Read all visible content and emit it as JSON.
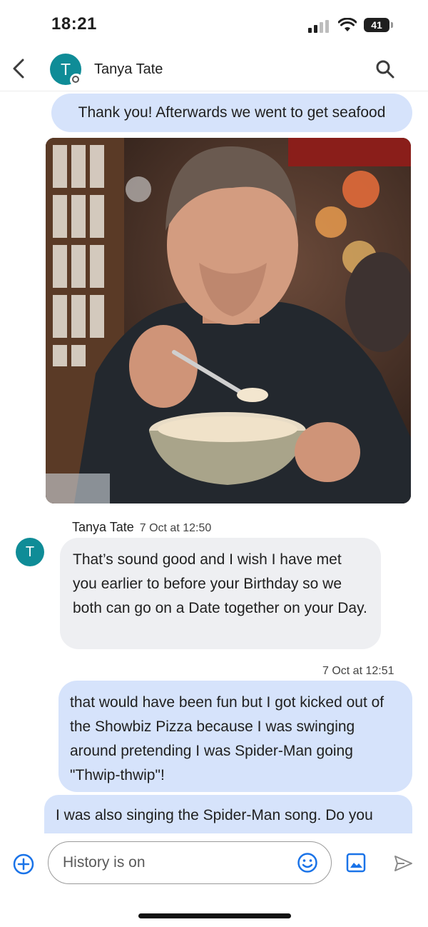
{
  "status_bar": {
    "time": "18:21",
    "battery": "41"
  },
  "header": {
    "avatar_initial": "T",
    "contact_name": "Tanya Tate"
  },
  "messages": [
    {
      "direction": "outgoing",
      "text": "Thank you! Afterwards we went to get seafood"
    },
    {
      "direction": "outgoing",
      "type": "image"
    },
    {
      "direction": "incoming",
      "sender": "Tanya Tate",
      "timestamp": "7 Oct at 12:50",
      "avatar_initial": "T",
      "text": "That’s sound good and I wish I have met you earlier to before your Birthday so we both can go on a Date together on your Day."
    },
    {
      "direction": "outgoing",
      "timestamp": "7 Oct at 12:51",
      "text": "that would have been fun but I got kicked out of the Showbiz Pizza because I was swinging around pretending I was Spider-Man going \"Thwip-thwip\"!"
    },
    {
      "direction": "outgoing",
      "text": "I was also singing the Spider-Man song. Do you"
    }
  ],
  "composer": {
    "placeholder": "History is on"
  },
  "icons": [
    "back-arrow-icon",
    "search-icon",
    "add-icon",
    "emoji-icon",
    "gallery-icon",
    "send-icon"
  ],
  "colors": {
    "outgoing_bubble": "#d6e3fb",
    "incoming_bubble": "#eeeff2",
    "avatar": "#0f8c97",
    "accent": "#1a73e8"
  }
}
